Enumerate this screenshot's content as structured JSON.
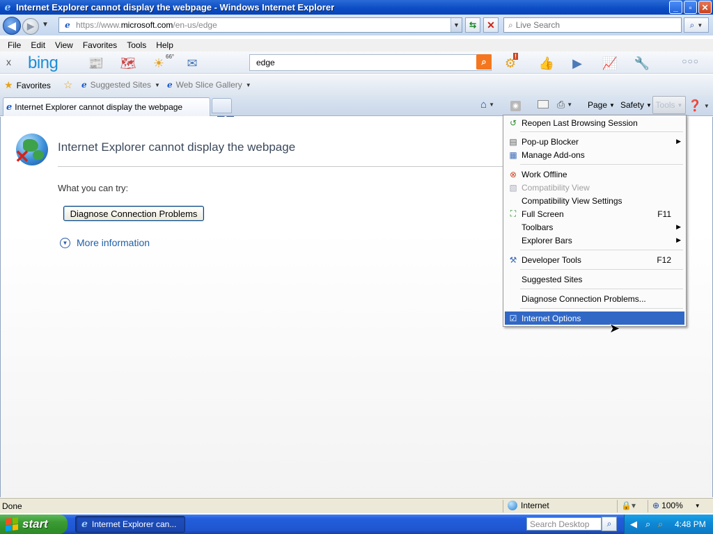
{
  "window": {
    "title": "Internet Explorer cannot display the webpage - Windows Internet Explorer",
    "buttons": {
      "minimize": "_",
      "maximize": "▫",
      "close": "✕"
    }
  },
  "nav": {
    "url_prefix": "https://www.",
    "url_domain": "microsoft.com",
    "url_suffix": "/en-us/edge",
    "live_search_placeholder": "Live Search"
  },
  "menubar": [
    "File",
    "Edit",
    "View",
    "Favorites",
    "Tools",
    "Help"
  ],
  "bing": {
    "close": "x",
    "logo": "bing",
    "weather": "66°",
    "search_value": "edge",
    "more": "○○○"
  },
  "favbar": {
    "favorites": "Favorites",
    "suggested_sites": "Suggested Sites",
    "web_slice_gallery": "Web Slice Gallery"
  },
  "tab": {
    "title": "Internet Explorer cannot display the webpage"
  },
  "commandbar": {
    "page": "Page",
    "safety": "Safety",
    "tools": "Tools"
  },
  "content": {
    "title": "Internet Explorer cannot display the webpage",
    "what_you_can_try": "What you can try:",
    "diagnose_button": "Diagnose Connection Problems",
    "more_information": "More information"
  },
  "tools_menu": {
    "items": [
      {
        "label": "Reopen Last Browsing Session",
        "shortcut": "",
        "submenu": false,
        "disabled": false,
        "selected": false,
        "icon": "reopen-icon"
      },
      {
        "label": "Pop-up Blocker",
        "shortcut": "",
        "submenu": true,
        "disabled": false,
        "selected": false,
        "icon": "popup-blocker-icon"
      },
      {
        "label": "Manage Add-ons",
        "shortcut": "",
        "submenu": false,
        "disabled": false,
        "selected": false,
        "icon": "addons-icon"
      },
      {
        "label": "Work Offline",
        "shortcut": "",
        "submenu": false,
        "disabled": false,
        "selected": false,
        "icon": "offline-icon"
      },
      {
        "label": "Compatibility View",
        "shortcut": "",
        "submenu": false,
        "disabled": true,
        "selected": false,
        "icon": "compat-icon"
      },
      {
        "label": "Compatibility View Settings",
        "shortcut": "",
        "submenu": false,
        "disabled": false,
        "selected": false,
        "icon": ""
      },
      {
        "label": "Full Screen",
        "shortcut": "F11",
        "submenu": false,
        "disabled": false,
        "selected": false,
        "icon": "fullscreen-icon"
      },
      {
        "label": "Toolbars",
        "shortcut": "",
        "submenu": true,
        "disabled": false,
        "selected": false,
        "icon": ""
      },
      {
        "label": "Explorer Bars",
        "shortcut": "",
        "submenu": true,
        "disabled": false,
        "selected": false,
        "icon": ""
      },
      {
        "label": "Developer Tools",
        "shortcut": "F12",
        "submenu": false,
        "disabled": false,
        "selected": false,
        "icon": "devtools-icon"
      },
      {
        "label": "Suggested Sites",
        "shortcut": "",
        "submenu": false,
        "disabled": false,
        "selected": false,
        "icon": ""
      },
      {
        "label": "Diagnose Connection Problems...",
        "shortcut": "",
        "submenu": false,
        "disabled": false,
        "selected": false,
        "icon": ""
      },
      {
        "label": "Internet Options",
        "shortcut": "",
        "submenu": false,
        "disabled": false,
        "selected": true,
        "icon": "options-icon"
      }
    ]
  },
  "statusbar": {
    "status": "Done",
    "zone": "Internet",
    "zoom": "100%"
  },
  "taskbar": {
    "start": "start",
    "task_label": "Internet Explorer can...",
    "search_desktop_placeholder": "Search Desktop",
    "clock": "4:48 PM"
  },
  "colors": {
    "title_bar": "#0a4bc4",
    "menu_selection": "#3168c6",
    "link": "#1f5fa8",
    "taskbar": "#245edb",
    "start_button": "#3a9a33"
  }
}
